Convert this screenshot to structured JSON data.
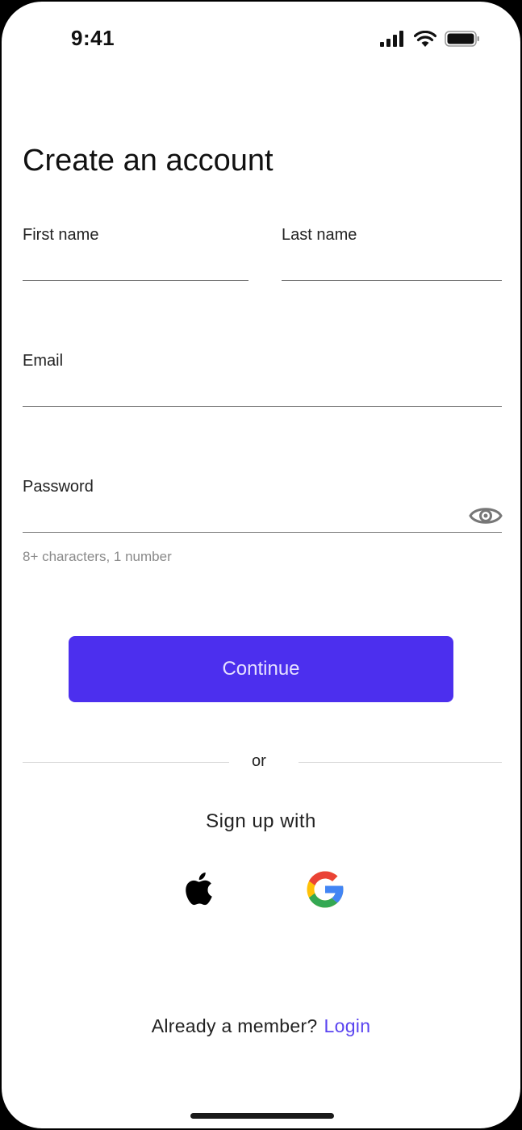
{
  "status_bar": {
    "time": "9:41",
    "icons": [
      "cellular-signal-icon",
      "wifi-icon",
      "battery-icon"
    ]
  },
  "page": {
    "title": "Create an account"
  },
  "form": {
    "first_name": {
      "label": "First name",
      "value": "",
      "placeholder": ""
    },
    "last_name": {
      "label": "Last name",
      "value": "",
      "placeholder": ""
    },
    "email": {
      "label": "Email",
      "value": "",
      "placeholder": ""
    },
    "password": {
      "label": "Password",
      "value": "",
      "placeholder": "",
      "hint": "8+ characters, 1 number",
      "toggle_icon": "eye-icon"
    }
  },
  "actions": {
    "continue_label": "Continue",
    "divider_text": "or",
    "signup_with_label": "Sign up with",
    "social_providers": [
      {
        "name": "Apple",
        "icon": "apple-icon"
      },
      {
        "name": "Google",
        "icon": "google-icon"
      }
    ]
  },
  "footer": {
    "prompt": "Already a member?",
    "login_label": "Login"
  },
  "colors": {
    "accent": "#4c2fee",
    "link": "#5a44f0",
    "hint_text": "#8a8a8a"
  }
}
